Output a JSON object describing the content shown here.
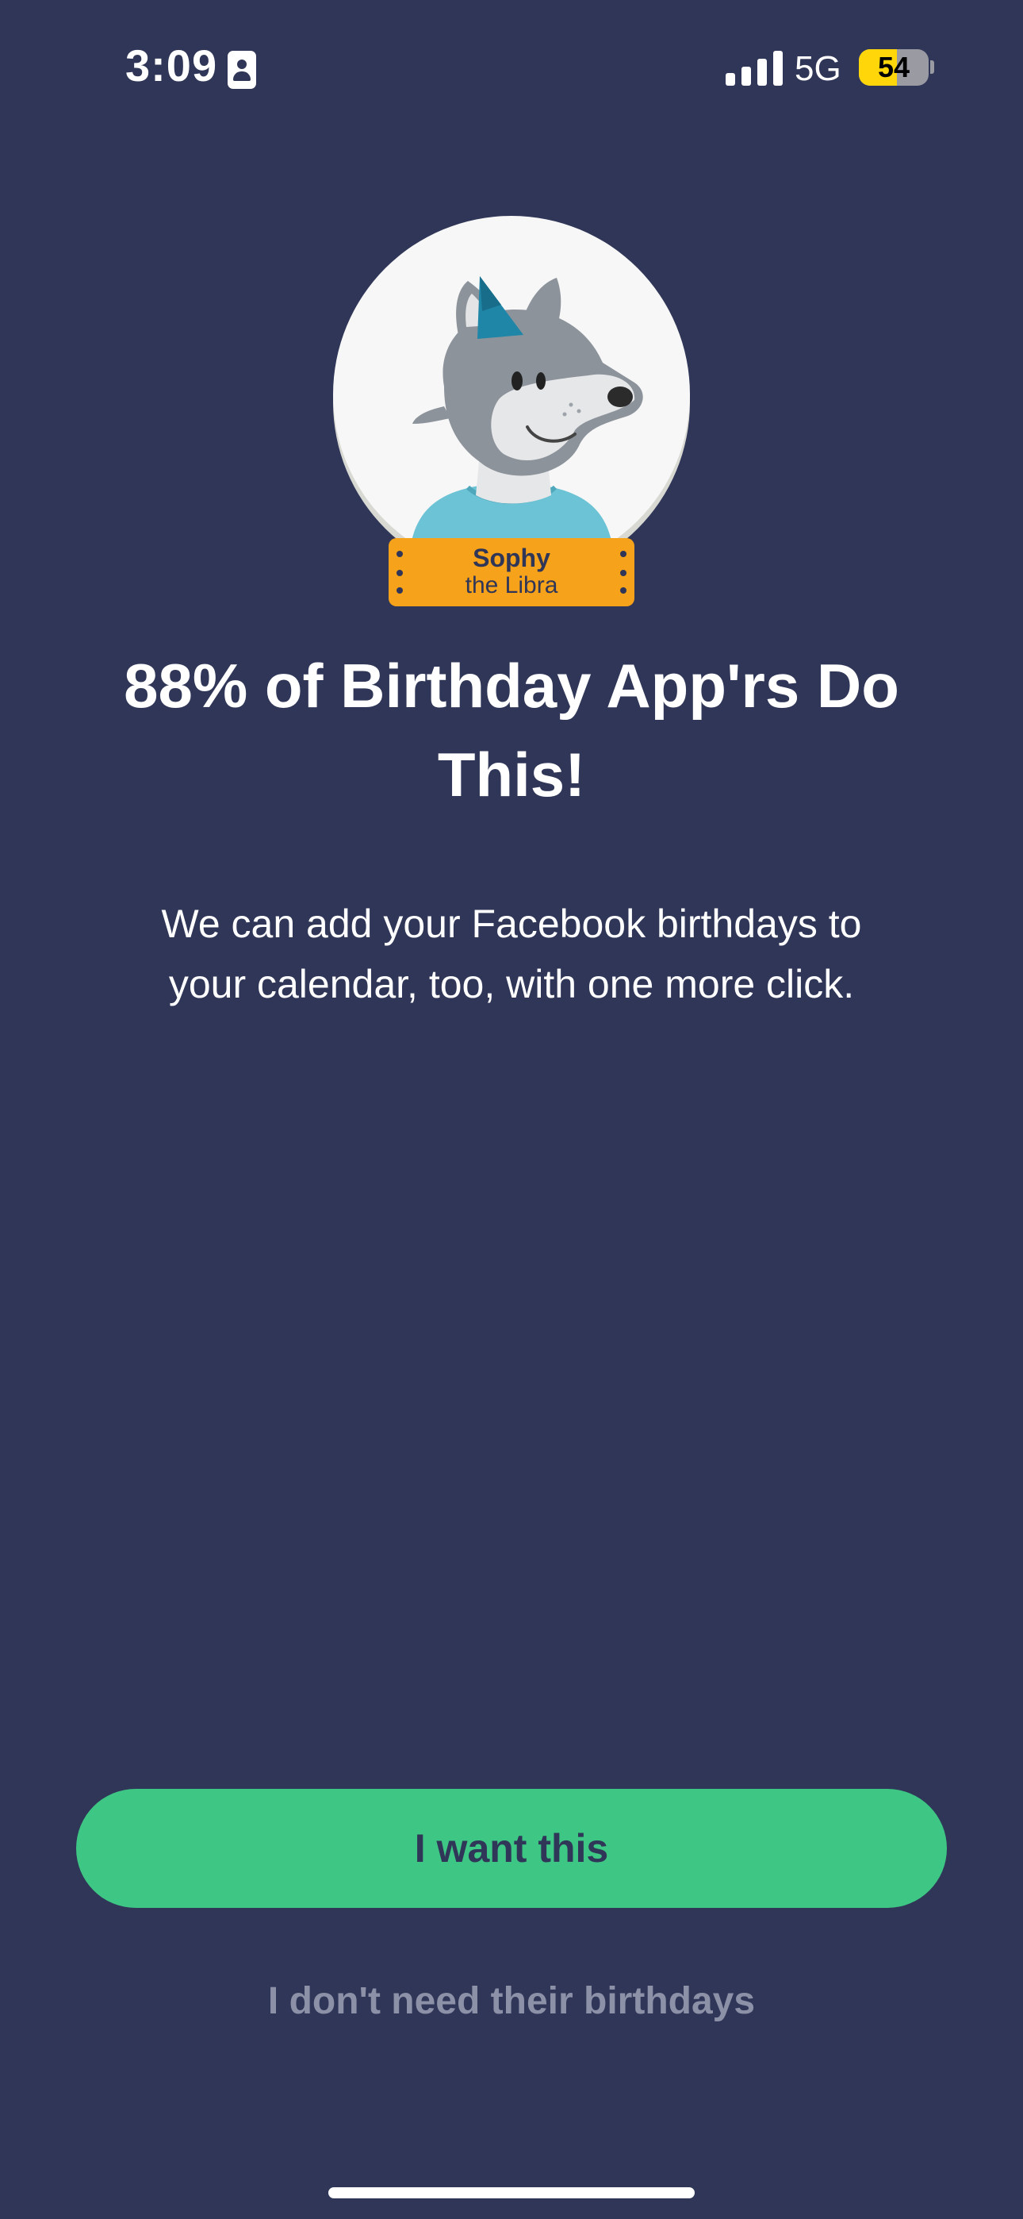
{
  "status_bar": {
    "time": "3:09",
    "network": "5G",
    "battery_level": "54",
    "battery_fraction": 0.54,
    "signal_bars": 4,
    "colors": {
      "battery_fill": "#ffd60a",
      "battery_empty": "#9a9aa3"
    }
  },
  "avatar": {
    "name": "Sophy",
    "sign_line": "the Libra",
    "colors": {
      "plate": "#f6a21a",
      "hat": "#1f86a8",
      "shirt": "#6cc3d5",
      "fur": "#8d939b"
    }
  },
  "content": {
    "headline": "88% of Birthday App'rs Do This!",
    "description": "We can add your Facebook birthdays to your calendar, too, with one more click."
  },
  "actions": {
    "primary_label": "I want this",
    "secondary_label": "I don't need their birthdays"
  },
  "theme": {
    "background": "#2f3657",
    "accent_green": "#3ec684",
    "muted_text": "#8c91a8"
  }
}
